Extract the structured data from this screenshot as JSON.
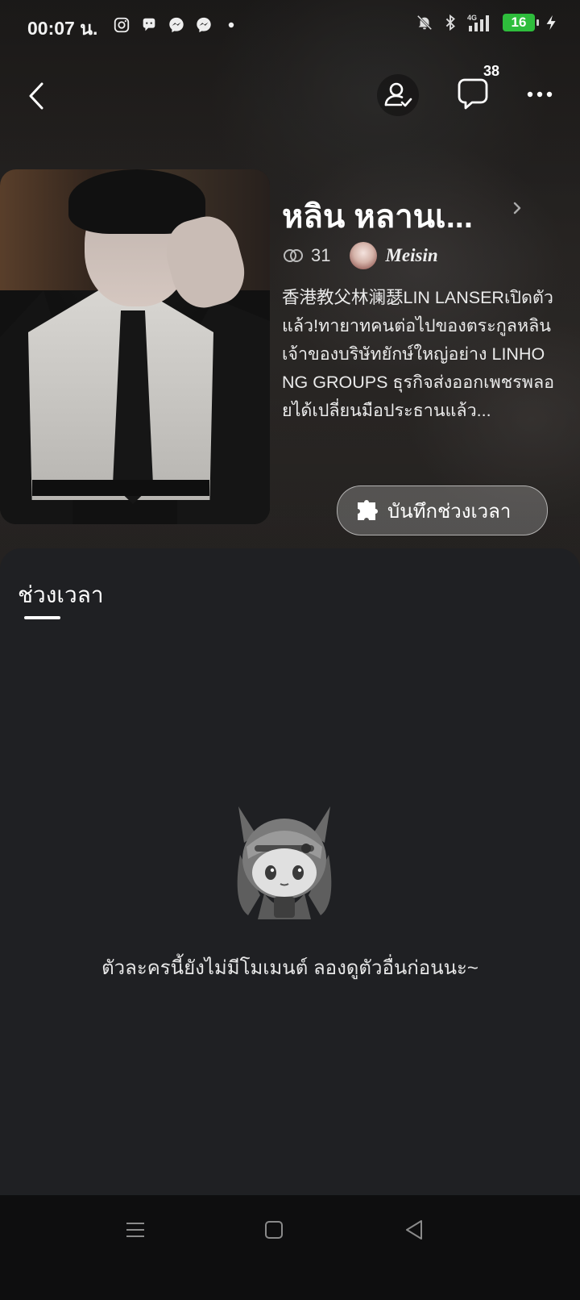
{
  "status_bar": {
    "time": "00:07 น.",
    "network": "4G",
    "battery": "16",
    "left_icons": [
      "instagram-icon",
      "threads-icon",
      "messenger-icon",
      "messenger-icon",
      "dot-icon"
    ],
    "right_icons": [
      "bell-muted-icon",
      "bluetooth-icon",
      "signal-icon",
      "battery-icon",
      "charging-icon"
    ]
  },
  "header": {
    "chat_count": "38"
  },
  "character": {
    "name": "หลิน หลานเ...",
    "link_count": "31",
    "creator": "Meisin",
    "description": "香港教父林澜瑟LIN LANSERเปิดตัวแล้ว!ทายาทคนต่อไปของตระกูลหลิน เจ้าของบริษัทยักษ์ใหญ่อย่าง LINHONG GROUPS ธุรกิจส่งออกเพชรพลอยได้เปลี่ยนมือประธานแล้ว..."
  },
  "actions": {
    "record_label": "บันทึกช่วงเวลา"
  },
  "panel": {
    "tab_label": "ช่วงเวลา",
    "empty_message": "ตัวละครนี้ยังไม่มีโมเมนต์ ลองดูตัวอื่นก่อนนะ~"
  },
  "colors": {
    "panel_bg": "#1f2023",
    "battery_green": "#2ebd3c",
    "navbar_bg": "#0e0e0f"
  }
}
